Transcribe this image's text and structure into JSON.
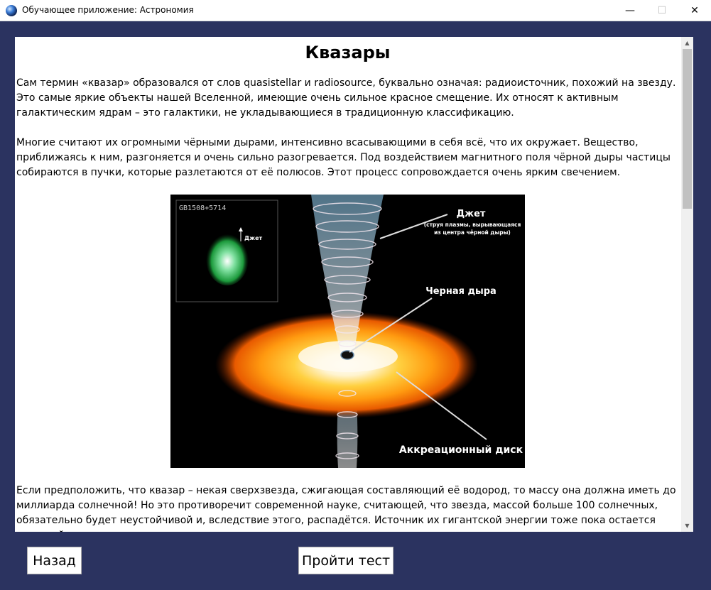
{
  "window": {
    "title": "Обучающее приложение: Астрономия",
    "controls": {
      "minimize": "—",
      "maximize": "☐",
      "close": "✕"
    }
  },
  "article": {
    "heading": "Квазары",
    "paragraphs": [
      "Сам термин «квазар» образовался от слов quasistellar и radiosource, буквально означая: радиоисточник, похожий на звезду. Это самые яркие объекты нашей Вселенной, имеющие очень сильное красное смещение. Их относят к активным галактическим ядрам – это галактики, не укладывающиеся в традиционную классификацию.",
      "Многие считают их огромными чёрными дырами, интенсивно всасывающими в себя всё, что их окружает. Вещество, приближаясь к ним, разгоняется и очень сильно разогревается. Под воздействием магнитного поля чёрной дыры частицы собираются в пучки, которые разлетаются от её полюсов. Этот процесс сопровождается очень ярким свечением.",
      "Если предположить, что квазар – некая сверхзвезда, сжигающая составляющий её водород, то массу она должна иметь до миллиарда солнечной! Но это противоречит современной науке, считающей, что звезда, массой больше 100 солнечных, обязательно будет неустойчивой и, вследствие этого, распадётся. Источник их гигантской энергии тоже пока остается загадкой."
    ],
    "figure": {
      "inset_id": "GB1508+5714",
      "inset_arrow_label": "Джет",
      "jet_label": "Джет",
      "jet_sublabel_1": "(струя плазмы, вырывающаяся",
      "jet_sublabel_2": "из центра чёрной дыры)",
      "black_hole_label": "Черная дыра",
      "disk_label": "Аккреационный диск"
    }
  },
  "buttons": {
    "back": "Назад",
    "test": "Пройти тест"
  },
  "colors": {
    "frame_bg": "#2b3360",
    "content_bg": "#ffffff"
  }
}
